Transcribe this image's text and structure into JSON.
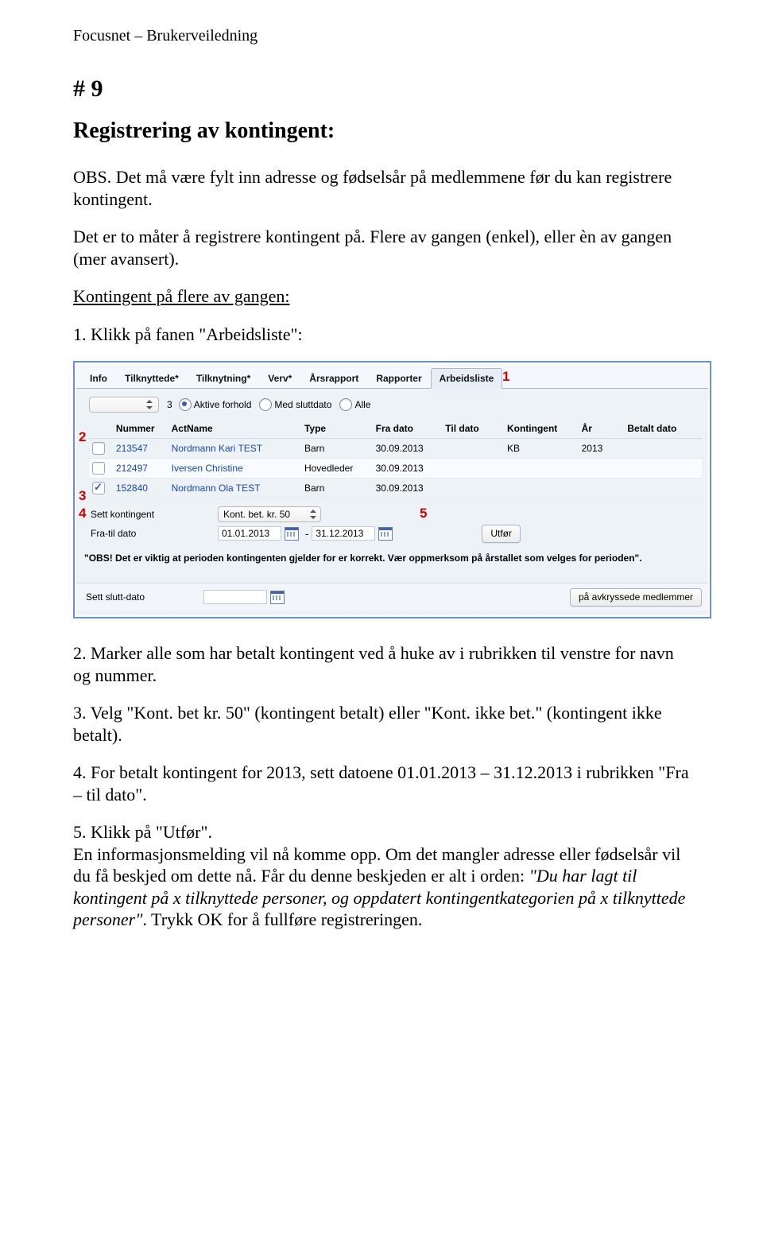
{
  "doc_header": "Focusnet – Brukerveiledning",
  "page_number": "# 9",
  "title": "Registrering av kontingent:",
  "p_intro": "OBS. Det må være fylt inn adresse og fødselsår på medlemmene før du kan registrere kontingent.",
  "p_two_ways": "Det er to måter å registrere kontingent på. Flere av gangen (enkel), eller èn av gangen (mer avansert).",
  "subhead": "Kontingent på flere av gangen:",
  "step1": "1. Klikk på fanen \"Arbeidsliste\":",
  "step2": "2. Marker alle som har betalt kontingent ved å huke av i rubrikken til venstre for navn og nummer.",
  "step3": "3. Velg \"Kont. bet kr. 50\" (kontingent betalt) eller \"Kont. ikke bet.\" (kontingent ikke betalt).",
  "step4": "4. For betalt kontingent for 2013, sett datoene 01.01.2013 – 31.12.2013 i rubrikken \"Fra – til dato\".",
  "step5_a": "5. Klikk på \"Utfør\".",
  "step5_b": "En informasjonsmelding vil nå komme opp. Om det mangler adresse eller fødselsår vil du få beskjed om dette nå. Får du denne beskjeden er alt i orden: ",
  "step5_quote": "\"Du har lagt til kontingent på x tilknyttede personer, og oppdatert kontingentkategorien på x tilknyttede personer\"",
  "step5_c": ". Trykk OK for å fullføre registreringen.",
  "shot": {
    "tabs": [
      "Info",
      "Tilknyttede*",
      "Tilknytning*",
      "Verv*",
      "Årsrapport",
      "Rapporter",
      "Arbeidsliste"
    ],
    "count": "3",
    "radios": {
      "aktive": "Aktive forhold",
      "slutt": "Med sluttdato",
      "alle": "Alle"
    },
    "headers": {
      "nummer": "Nummer",
      "actname": "ActName",
      "type": "Type",
      "fra": "Fra dato",
      "til": "Til dato",
      "kont": "Kontingent",
      "ar": "År",
      "betalt": "Betalt dato"
    },
    "rows": [
      {
        "checked": false,
        "nummer": "213547",
        "name": "Nordmann Kari TEST",
        "type": "Barn",
        "fra": "30.09.2013",
        "til": "",
        "kont": "KB",
        "ar": "2013",
        "betalt": ""
      },
      {
        "checked": false,
        "nummer": "212497",
        "name": "Iversen Christine",
        "type": "Hovedleder",
        "fra": "30.09.2013",
        "til": "",
        "kont": "",
        "ar": "",
        "betalt": ""
      },
      {
        "checked": true,
        "nummer": "152840",
        "name": "Nordmann Ola TEST",
        "type": "Barn",
        "fra": "30.09.2013",
        "til": "",
        "kont": "",
        "ar": "",
        "betalt": ""
      }
    ],
    "sett_kont_label": "Sett kontingent",
    "sett_kont_value": "Kont. bet. kr. 50",
    "fratil_label": "Fra-til dato",
    "date_from": "01.01.2013",
    "date_to": "31.12.2013",
    "utfor": "Utfør",
    "obs": "\"OBS! Det er viktig at perioden kontingenten gjelder for er korrekt. Vær oppmerksom på årstallet som velges for perioden\".",
    "sett_slutt": "Sett slutt-dato",
    "pa_avkryssede": "på avkryssede medlemmer",
    "ann": {
      "a1": "1",
      "a2": "2",
      "a3": "3",
      "a4": "4",
      "a5": "5"
    }
  }
}
